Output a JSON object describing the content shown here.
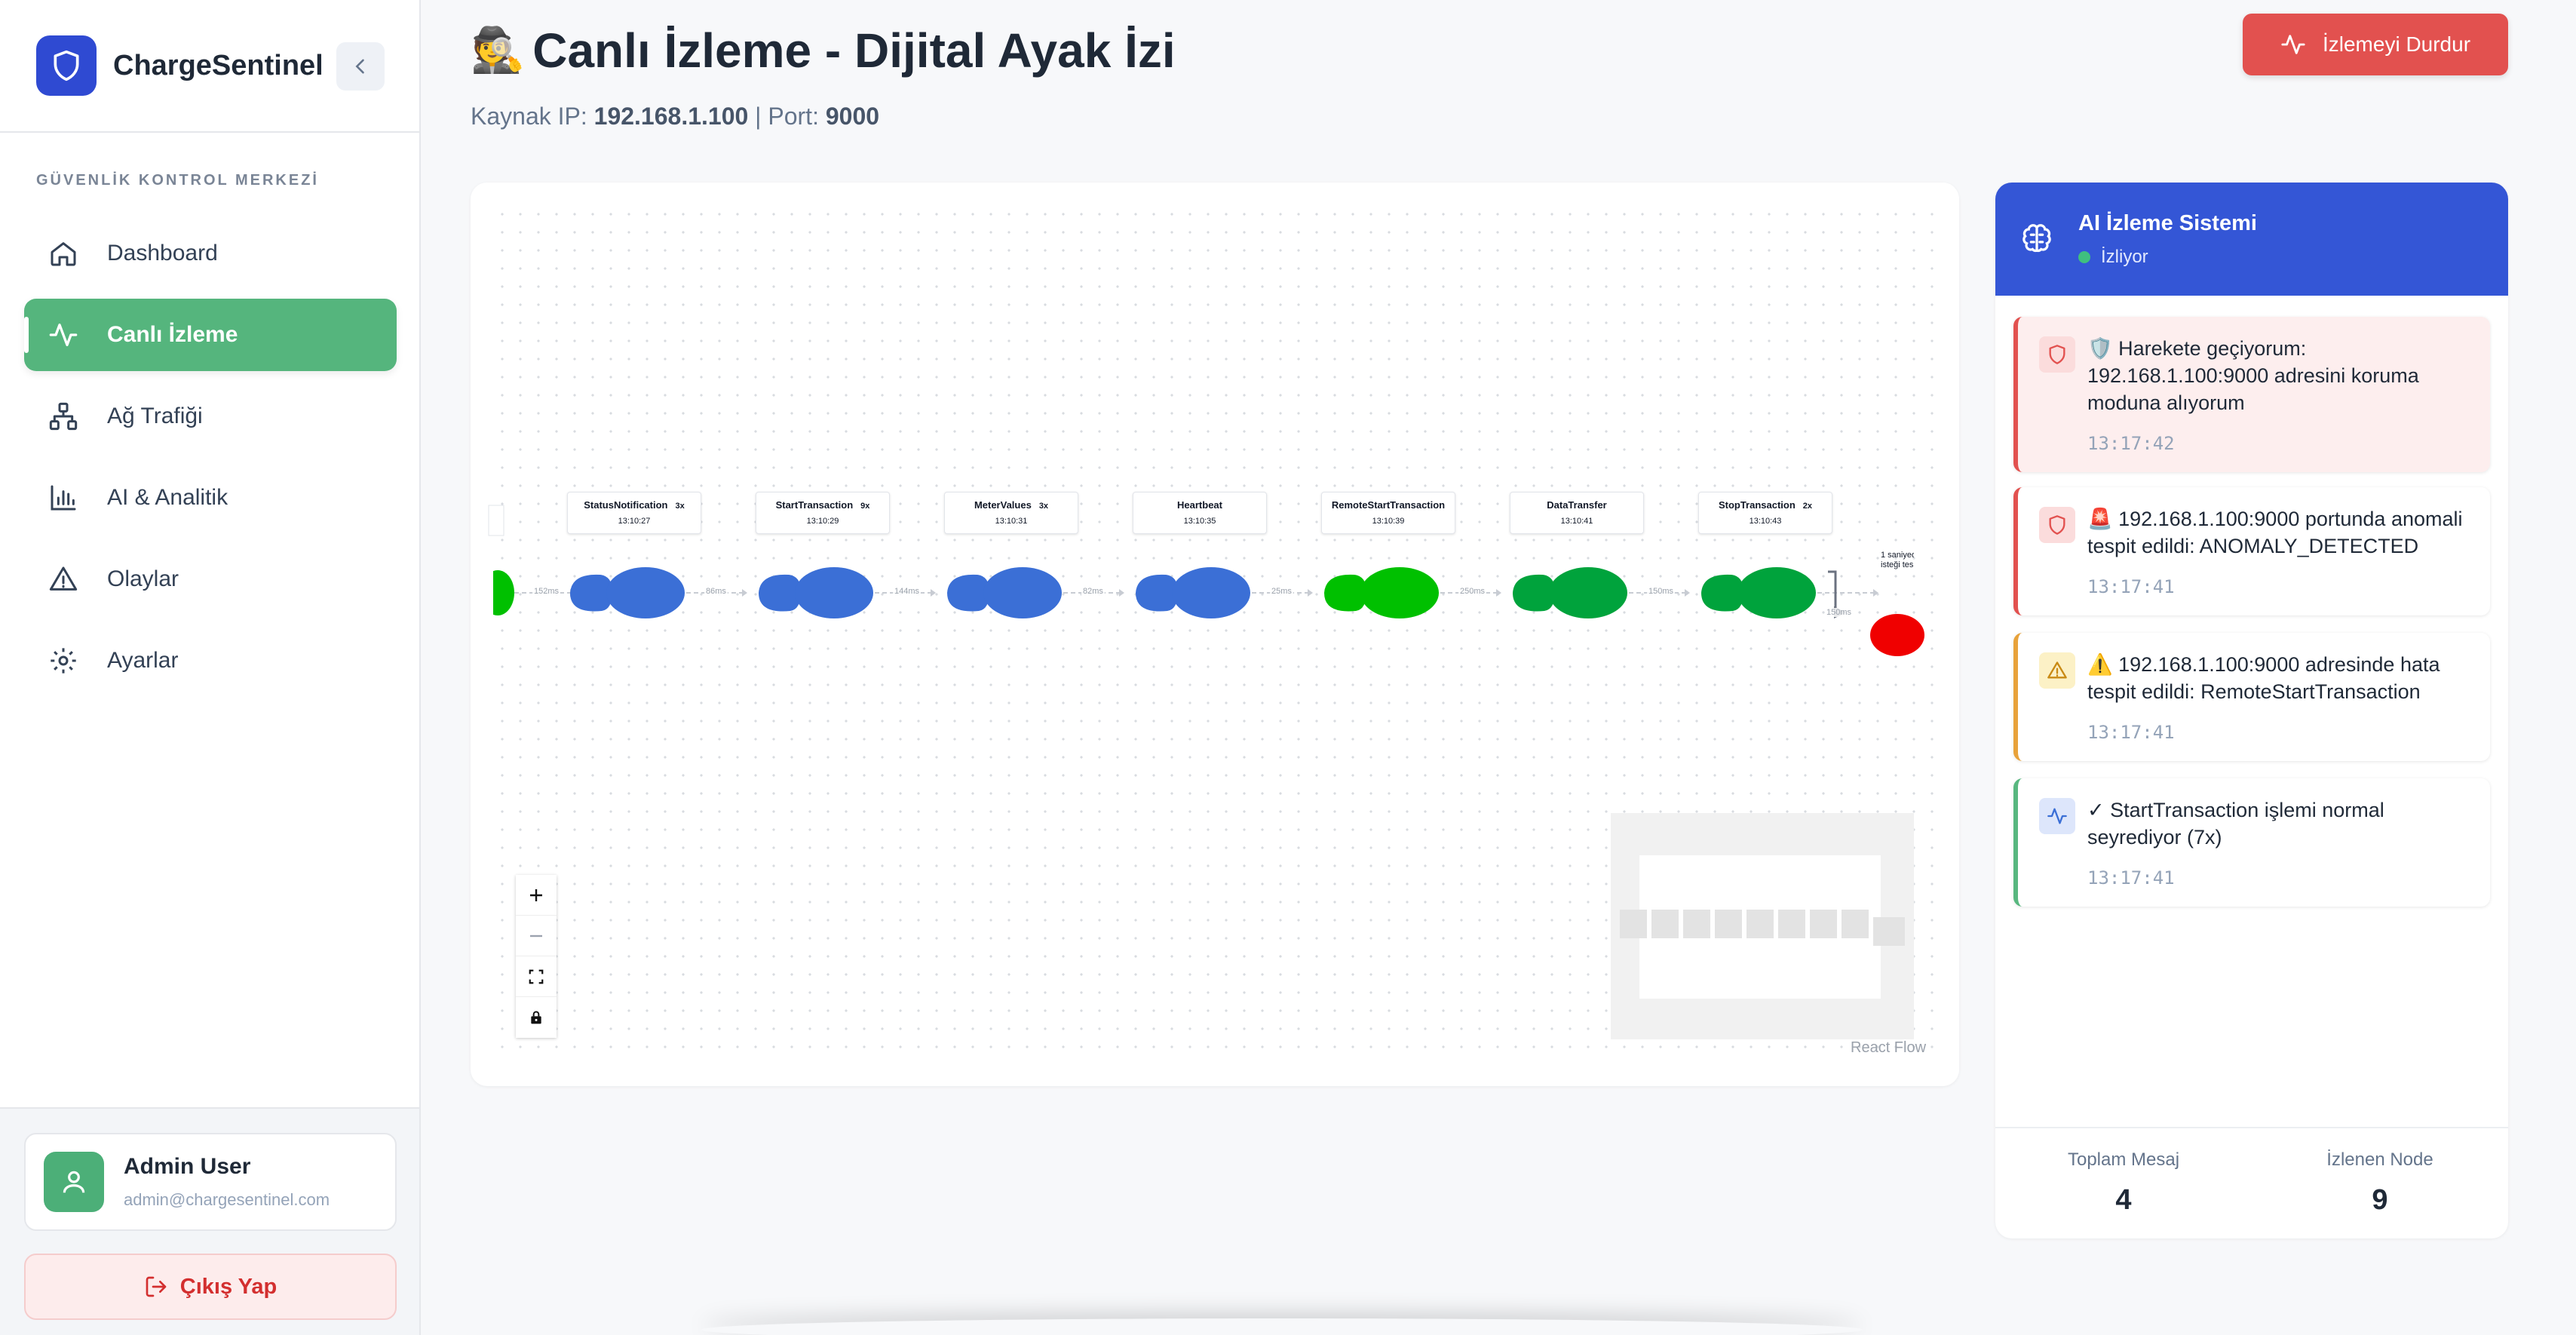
{
  "app": {
    "name": "ChargeSentinel"
  },
  "sidebar": {
    "section_label": "GÜVENLİK KONTROL MERKEZİ",
    "items": [
      {
        "label": "Dashboard",
        "icon": "home-icon",
        "active": false
      },
      {
        "label": "Canlı İzleme",
        "icon": "activity-icon",
        "active": true
      },
      {
        "label": "Ağ Trafiği",
        "icon": "network-icon",
        "active": false
      },
      {
        "label": "AI & Analitik",
        "icon": "bar-chart-icon",
        "active": false
      },
      {
        "label": "Olaylar",
        "icon": "alert-triangle-icon",
        "active": false
      },
      {
        "label": "Ayarlar",
        "icon": "gear-icon",
        "active": false
      }
    ]
  },
  "user": {
    "name": "Admin User",
    "email": "admin@chargesentinel.com",
    "logout_label": "Çıkış Yap"
  },
  "page": {
    "title_emoji": "🕵️",
    "title": "Canlı İzleme - Dijital Ayak İzi",
    "source_ip_label": "Kaynak IP:",
    "source_ip": "192.168.1.100",
    "port_label": "| Port:",
    "port": "9000",
    "stop_button_label": "İzlemeyi Durdur"
  },
  "flow": {
    "nodes": [
      {
        "name": "StatusNotification",
        "count": "3x",
        "time": "13:10:27",
        "color": "#3b6fd6"
      },
      {
        "name": "StartTransaction",
        "count": "9x",
        "time": "13:10:29",
        "color": "#3b6fd6"
      },
      {
        "name": "MeterValues",
        "count": "3x",
        "time": "13:10:31",
        "color": "#3b6fd6"
      },
      {
        "name": "Heartbeat",
        "count": "",
        "time": "13:10:35",
        "color": "#3b6fd6"
      },
      {
        "name": "RemoteStartTransaction",
        "count": "",
        "time": "13:10:39",
        "color": "#00c000"
      },
      {
        "name": "DataTransfer",
        "count": "",
        "time": "13:10:41",
        "color": "#00a33c"
      },
      {
        "name": "StopTransaction",
        "count": "2x",
        "time": "13:10:43",
        "color": "#00a33c"
      }
    ],
    "edges": [
      "152ms",
      "86ms",
      "144ms",
      "82ms",
      "25ms",
      "250ms",
      "150ms",
      "150ms"
    ],
    "cut_node_text": "1 saniyede\nisteği tes",
    "attribution": "React Flow"
  },
  "ai_panel": {
    "title": "AI İzleme Sistemi",
    "status": "İzliyor",
    "alerts": [
      {
        "type": "danger",
        "icon": "shield-icon",
        "text": "🛡️ Harekete geçiyorum: 192.168.1.100:9000 adresini koruma moduna alıyorum",
        "time": "13:17:42"
      },
      {
        "type": "danger",
        "icon": "shield-icon",
        "text": "🚨 192.168.1.100:9000 portunda anomali tespit edildi: ANOMALY_DETECTED",
        "time": "13:17:41"
      },
      {
        "type": "warning",
        "icon": "alert-triangle-icon",
        "text": "⚠️ 192.168.1.100:9000 adresinde hata tespit edildi: RemoteStartTransaction",
        "time": "13:17:41"
      },
      {
        "type": "info",
        "icon": "activity-icon",
        "text": "✓ StartTransaction işlemi normal seyrediyor (7x)",
        "time": "13:17:41"
      }
    ],
    "stats": [
      {
        "label": "Toplam Mesaj",
        "value": "4"
      },
      {
        "label": "İzlenen Node",
        "value": "9"
      }
    ]
  },
  "colors": {
    "accent_green": "#55b57d",
    "brand_blue": "#2f4ad2",
    "panel_blue": "#3456d6",
    "danger_red": "#e2514f",
    "warning_amber": "#e8a23a",
    "node_blue": "#3b6fd6",
    "node_green": "#00a33c",
    "node_red": "#f00000"
  }
}
